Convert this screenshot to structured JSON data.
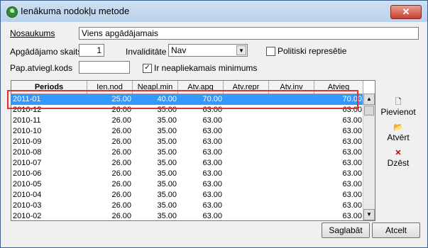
{
  "window": {
    "title": "Ienākuma nodokļu metode"
  },
  "form": {
    "nosaukums_label": "Nosaukums",
    "nosaukums_value": "Viens apgādājamais",
    "apgadajamo_label": "Apgādājamo skaits",
    "apgadajamo_value": "1",
    "invaliditate_label": "Invaliditāte",
    "invaliditate_value": "Nav",
    "politiski_label": "Politiski represētie",
    "politiski_checked": false,
    "pap_label": "Pap.atviegl.kods",
    "pap_value": "",
    "neapliek_label": "Ir neapliekamais minimums",
    "neapliek_checked": true
  },
  "grid": {
    "columns": [
      "Periods",
      "Ien.nod",
      "Neapl.min",
      "Atv.apg",
      "Atv.repr",
      "Atv.inv",
      "Atvieg"
    ],
    "rows": [
      [
        "2011-01",
        "25.00",
        "40.00",
        "70.00",
        "",
        "",
        "70.00"
      ],
      [
        "2010-12",
        "26.00",
        "35.00",
        "63.00",
        "",
        "",
        "63.00"
      ],
      [
        "2010-11",
        "26.00",
        "35.00",
        "63.00",
        "",
        "",
        "63.00"
      ],
      [
        "2010-10",
        "26.00",
        "35.00",
        "63.00",
        "",
        "",
        "63.00"
      ],
      [
        "2010-09",
        "26.00",
        "35.00",
        "63.00",
        "",
        "",
        "63.00"
      ],
      [
        "2010-08",
        "26.00",
        "35.00",
        "63.00",
        "",
        "",
        "63.00"
      ],
      [
        "2010-07",
        "26.00",
        "35.00",
        "63.00",
        "",
        "",
        "63.00"
      ],
      [
        "2010-06",
        "26.00",
        "35.00",
        "63.00",
        "",
        "",
        "63.00"
      ],
      [
        "2010-05",
        "26.00",
        "35.00",
        "63.00",
        "",
        "",
        "63.00"
      ],
      [
        "2010-04",
        "26.00",
        "35.00",
        "63.00",
        "",
        "",
        "63.00"
      ],
      [
        "2010-03",
        "26.00",
        "35.00",
        "63.00",
        "",
        "",
        "63.00"
      ],
      [
        "2010-02",
        "26.00",
        "35.00",
        "63.00",
        "",
        "",
        "63.00"
      ]
    ],
    "selected_row": 0
  },
  "actions": {
    "pievienot": "Pievienot",
    "atvert": "Atvērt",
    "dzest": "Dzēst"
  },
  "buttons": {
    "saglabat": "Saglabāt",
    "atcelt": "Atcelt"
  },
  "colors": {
    "selection": "#3399ff",
    "highlight": "#e03030"
  }
}
